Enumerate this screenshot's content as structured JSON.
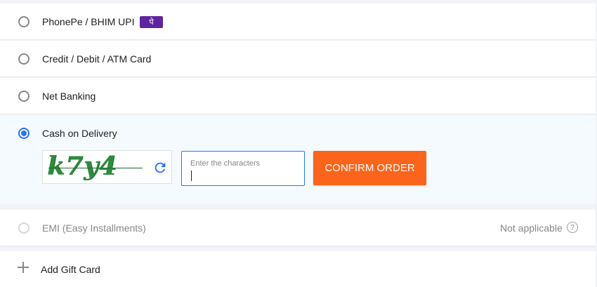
{
  "payment_options": {
    "phonepe": {
      "label": "PhonePe / BHIM UPI",
      "badge": "पे"
    },
    "card": {
      "label": "Credit / Debit / ATM Card"
    },
    "netbanking": {
      "label": "Net Banking"
    },
    "cod": {
      "label": "Cash on Delivery",
      "captcha_text": "k7y4",
      "input_placeholder": "Enter the characters",
      "input_value": "",
      "confirm_label": "CONFIRM ORDER"
    },
    "emi": {
      "label": "EMI (Easy Installments)",
      "status": "Not applicable",
      "help": "?"
    }
  },
  "gift_card": {
    "label": "Add Gift Card"
  },
  "colors": {
    "accent_blue": "#2874f0",
    "confirm_orange": "#fb641b",
    "phonepe_purple": "#5f259f",
    "captcha_green": "#2e8b3e"
  },
  "icons": {
    "refresh": "refresh-icon",
    "help": "help-icon",
    "add": "plus-icon"
  }
}
